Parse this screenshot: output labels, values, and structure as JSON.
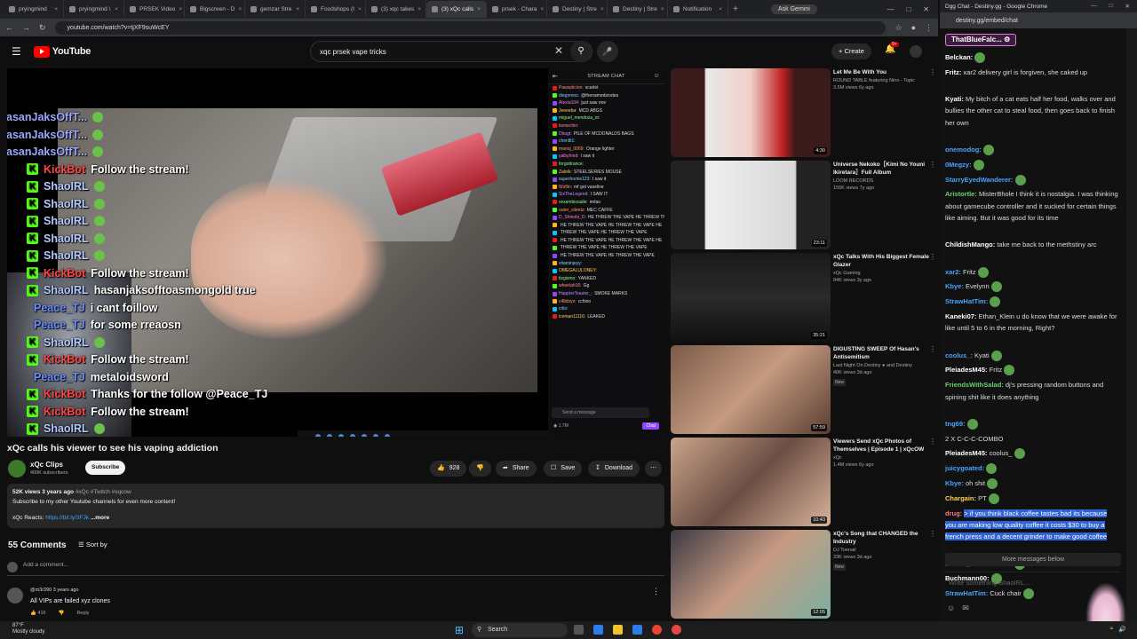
{
  "browser_left": {
    "tabs": [
      {
        "label": "pryingmind",
        "active": false
      },
      {
        "label": "pryingmind \\",
        "active": false
      },
      {
        "label": "PRSEK Video",
        "active": false
      },
      {
        "label": "Bigscreen - D",
        "active": false
      },
      {
        "label": "gemzar Stre",
        "active": false
      },
      {
        "label": "Foodshops (I",
        "active": false
      },
      {
        "label": "(3) xqc takes",
        "active": false
      },
      {
        "label": "(3) xQc calls",
        "active": true
      },
      {
        "label": "prsek - Chara",
        "active": false
      },
      {
        "label": "Destiny | Stre",
        "active": false
      },
      {
        "label": "Destiny | Stre",
        "active": false
      },
      {
        "label": "Notification",
        "active": false
      }
    ],
    "new_tab": "+",
    "ask_gemini": "Ask Gemini",
    "url": "youtube.com/watch?v=tjXF9suWcEY"
  },
  "youtube": {
    "logo": "YouTube",
    "search_value": "xqc prsek vape tricks",
    "create_label": "Create",
    "bell_badge": "9+",
    "video": {
      "overlay_lines": [
        {
          "user": "HasanJaksOffT...",
          "msg": "",
          "color": "#9aa7ff",
          "badge": false
        },
        {
          "user": "HasanJaksOffT...",
          "msg": "",
          "color": "#9aa7ff",
          "badge": false
        },
        {
          "user": "HasanJaksOffT...",
          "msg": "",
          "color": "#9aa7ff",
          "badge": false
        },
        {
          "user": "KickBot",
          "msg": "Follow the stream!",
          "color": "#ff4444",
          "badge": true
        },
        {
          "user": "ShaoIRL",
          "msg": "",
          "color": "#b3c8ff",
          "badge": true
        },
        {
          "user": "ShaoIRL",
          "msg": "",
          "color": "#b3c8ff",
          "badge": true
        },
        {
          "user": "ShaoIRL",
          "msg": "",
          "color": "#b3c8ff",
          "badge": true
        },
        {
          "user": "ShaoIRL",
          "msg": "",
          "color": "#b3c8ff",
          "badge": true
        },
        {
          "user": "ShaoIRL",
          "msg": "",
          "color": "#b3c8ff",
          "badge": true
        },
        {
          "user": "KickBot",
          "msg": "Follow the stream!",
          "color": "#ff4444",
          "badge": true
        },
        {
          "user": "ShaoIRL",
          "msg": "hasanjaksofftoasmongold true",
          "color": "#b3c8ff",
          "badge": true
        },
        {
          "user": "Peace_TJ",
          "msg": "i cant foillow",
          "color": "#6a8cff",
          "badge": false
        },
        {
          "user": "Peace_TJ",
          "msg": "for some rreaosn",
          "color": "#6a8cff",
          "badge": false
        },
        {
          "user": "ShaoIRL",
          "msg": "",
          "color": "#b3c8ff",
          "badge": true
        },
        {
          "user": "KickBot",
          "msg": "Follow the stream!",
          "color": "#ff4444",
          "badge": true
        },
        {
          "user": "Peace_TJ",
          "msg": "metaloidsword",
          "color": "#6a8cff",
          "badge": false
        },
        {
          "user": "KickBot",
          "msg": "Thanks for the follow @Peace_TJ",
          "color": "#ff4444",
          "badge": true
        },
        {
          "user": "KickBot",
          "msg": "Follow the stream!",
          "color": "#ff4444",
          "badge": true
        },
        {
          "user": "ShaoIRL",
          "msg": "",
          "color": "#b3c8ff",
          "badge": true
        }
      ],
      "stream_chat_title": "STREAM CHAT",
      "stream_chat": [
        {
          "u": "Pawsplicion:",
          "t": "scarlet",
          "c": "#ff8c8c"
        },
        {
          "u": "diegomos:",
          "t": "@thenamedsrvdes",
          "c": "#7fd3ff"
        },
        {
          "u": "Alexia104:",
          "t": "just saw one",
          "c": "#ff7bd5"
        },
        {
          "u": "Jeeeeba:",
          "t": "MCD ABGS",
          "c": "#ffd15c"
        },
        {
          "u": "miguel_mendoza_m:",
          "t": "",
          "c": "#8cff8c"
        },
        {
          "u": "itsmechin:",
          "t": "",
          "c": "#ff8c8c"
        },
        {
          "u": "Dbugt:",
          "t": "PILE OF MCDONALDS BAGS",
          "c": "#c08cff"
        },
        {
          "u": "chenllt1:",
          "t": "",
          "c": "#7fd3ff"
        },
        {
          "u": "manoj_0069:",
          "t": "Orange lighter",
          "c": "#ff9f5c"
        },
        {
          "u": "yalbyhind:",
          "t": "I saw it",
          "c": "#ff7bd5"
        },
        {
          "u": "forgottrance:",
          "t": "",
          "c": "#8cff8c"
        },
        {
          "u": "Zakrik:",
          "t": "STEELSERIES MOUSE",
          "c": "#ffd15c"
        },
        {
          "u": "superhomie123:",
          "t": "I saw it",
          "c": "#7fd3ff"
        },
        {
          "u": "Wsflin:",
          "t": "mf got vaseline",
          "c": "#ff8c8c"
        },
        {
          "u": "SixTheLegend:",
          "t": "I SAW IT",
          "c": "#c08cff"
        },
        {
          "u": "vexsmbiosalle:",
          "t": "imfao",
          "c": "#8cff8c"
        },
        {
          "u": "outer_silentz:",
          "t": "MEC CAFFE",
          "c": "#ff9f5c"
        },
        {
          "u": "D_Shinobi_D:",
          "t": "HE THREW THE VAPE HE THREW THE VAPE",
          "c": "#ff7bd5"
        },
        {
          "u": "",
          "t": "HE THREW THE VAPE HE THREW THE VAPE HE",
          "c": "#ff7bd5"
        },
        {
          "u": "",
          "t": "THREW THE VAPE HE THREW THE VAPE",
          "c": "#ff7bd5"
        },
        {
          "u": "",
          "t": "HE THREW THE VAPE HE THREW THE VAPE HE",
          "c": "#ff7bd5"
        },
        {
          "u": "",
          "t": "THREW THE VAPE HE THREW THE VAPE",
          "c": "#ff7bd5"
        },
        {
          "u": "",
          "t": "HE THREW THE VAPE HE THREW THE VAPE",
          "c": "#ff7bd5"
        },
        {
          "u": "vitaminjeyy:",
          "t": "",
          "c": "#7fd3ff"
        },
        {
          "u": "OMEGALULONEY:",
          "t": "",
          "c": "#ffd15c"
        },
        {
          "u": "itzgismo:",
          "t": "YANKED",
          "c": "#8cff8c"
        },
        {
          "u": "wheelah16:",
          "t": "Gg",
          "c": "#ff8c8c"
        },
        {
          "u": "HappierTeaster_:",
          "t": "SMOKE MARKS",
          "c": "#c08cff"
        },
        {
          "u": "c4lbbiyo:",
          "t": "cchino",
          "c": "#ff9f5c"
        },
        {
          "u": "crlio:",
          "t": "",
          "c": "#7fd3ff"
        },
        {
          "u": "iceman11116:",
          "t": "LEAKED",
          "c": "#ffd15c"
        }
      ],
      "send_placeholder": "Send a message",
      "viewer_count": "1.7M",
      "chat_button": "Chat"
    },
    "title": "xQc calls his viewer to see his vaping addiction",
    "channel": {
      "name": "xQc Clips",
      "subs": "400K subscribers",
      "subscribe": "Subscribe"
    },
    "actions": {
      "likes": "928",
      "share": "Share",
      "save": "Save",
      "download": "Download"
    },
    "description": {
      "meta": "52K views  3 years ago",
      "tags": " #xQc #Twitch #xqcow",
      "line1": "Subscribe to my other Youtube channels for even more content!",
      "line2_prefix": "xQc Reacts: ",
      "line2_link": "https://bit.ly/3FJk",
      "more": "...more"
    },
    "comments": {
      "count": "55 Comments",
      "sort": "Sort by",
      "add_placeholder": "Add a comment...",
      "first": {
        "user": "@m3r390  3 years ago",
        "text": "All VIPs are failed xyz clones",
        "likes": "416",
        "reply": "Reply"
      }
    },
    "recommendations": [
      {
        "title": "Let Me Be With You",
        "channel": "ROUND TABLE featuring Nino - Topic",
        "stats": "3.5M views  6y ago",
        "duration": "4:30",
        "new": ""
      },
      {
        "title": "Universe Nekoko［Kimi No Youni Ikiretara］Full Album",
        "channel": "LOOM RECORDS",
        "stats": "155K views  7y ago",
        "duration": "23:11",
        "new": ""
      },
      {
        "title": "xQc Talks With His Biggest Female Glazer",
        "channel": "xQc Gaming",
        "stats": "84K views  3y ago",
        "duration": "35:21",
        "new": ""
      },
      {
        "title": "DIGUSTING SWEEP Of Hasan's Antisemitism",
        "channel": "Last Night On Destiny ● and Destiny",
        "stats": "40K views  3d ago",
        "duration": "57:59",
        "new": "New"
      },
      {
        "title": "Viewers Send xQc Photos of Themselves | Episode 1 | xQcOW",
        "channel": "xQc",
        "stats": "1.4M views  6y ago",
        "duration": "10:43",
        "new": ""
      },
      {
        "title": "xQc's Song that CHANGED the Industry",
        "channel": "DJ Toenail",
        "stats": "33K views  3d ago",
        "duration": "12:05",
        "new": "New"
      }
    ]
  },
  "destiny_window": {
    "title": "Dgg Chat - Destiny.gg - Google Chrome",
    "url": "destiny.gg/embed/chat",
    "top_user": "ThatBlueFalc...",
    "messages": [
      {
        "u": "Belckan:",
        "t": "",
        "c": "#ffffff"
      },
      {
        "u": "Fritz:",
        "t": "xar2 delivery girl is forgiven, she caked up",
        "c": "#ffffff"
      },
      {
        "u": "Kyati:",
        "t": "My bitch of a cat eats half her food, walks over and bullies the other cat to steal food, then goes back to finish her own",
        "c": "#ffffff"
      },
      {
        "u": "onemodog:",
        "t": "",
        "c": "#4aa3ff"
      },
      {
        "u": "0Megzy:",
        "t": "",
        "c": "#4aa3ff"
      },
      {
        "u": "StarryEyedWanderer:",
        "t": "",
        "c": "#4aa3ff"
      },
      {
        "u": "Aristortle:",
        "t": "MisterBhole I think it is nostalgia. I was thinking about gamecube controller and it sucked for certain things like aiming. But it was good for its time",
        "c": "#6cd06c"
      },
      {
        "u": "ChildishMango:",
        "t": "take me back to the methstiny arc",
        "c": "#ffffff"
      },
      {
        "u": "xar2:",
        "t": "Fritz",
        "c": "#4aa3ff"
      },
      {
        "u": "Kbye:",
        "t": "Evelynn",
        "c": "#4aa3ff"
      },
      {
        "u": "StrawHatTim:",
        "t": "",
        "c": "#4aa3ff"
      },
      {
        "u": "Kaneki07:",
        "t": "Ethan_Klein u do know that we were awake for like until 5 to 6 in the morning, Right?",
        "c": "#ffffff"
      },
      {
        "u": "coolus_:",
        "t": "Kyati",
        "c": "#4aa3ff"
      },
      {
        "u": "PleiadesM45:",
        "t": "Fritz",
        "c": "#ffffff"
      },
      {
        "u": "FriendsWithSalad:",
        "t": "dj's pressing random buttons and spining shit like it does anything",
        "c": "#6cd06c"
      },
      {
        "u": "tng69:",
        "t": "",
        "c": "#4aa3ff"
      },
      {
        "u": "",
        "t": "2 X  C-C-C-COMBO",
        "c": "#ffffff"
      },
      {
        "u": "PleiadesM45:",
        "t": "coolus_",
        "c": "#ffffff"
      },
      {
        "u": "juicygoated:",
        "t": "",
        "c": "#4aa3ff"
      },
      {
        "u": "Kbye:",
        "t": "oh shit",
        "c": "#4aa3ff"
      },
      {
        "u": "Chargain:",
        "t": "PT",
        "c": "#ffd15c"
      },
      {
        "u": "drug:",
        "t": "> if you think black coffee tastes bad its because you are making low quality coffee it costs $30 to buy a french press and a decent grinder to make good coffee",
        "c": "#ff7b7b"
      },
      {
        "u": "coolus_:",
        "t": "PleiadesM45",
        "c": "#4aa3ff"
      },
      {
        "u": "Buchmann00:",
        "t": "",
        "c": "#ffffff"
      },
      {
        "u": "StrawHatTim:",
        "t": "Cuck chair",
        "c": "#4aa3ff"
      }
    ],
    "more_below": "More messages below",
    "input_placeholder": "Write something ShaoIRL..."
  },
  "taskbar": {
    "weather_temp": "87°F",
    "weather_desc": "Mostly cloudy",
    "search": "Search"
  }
}
